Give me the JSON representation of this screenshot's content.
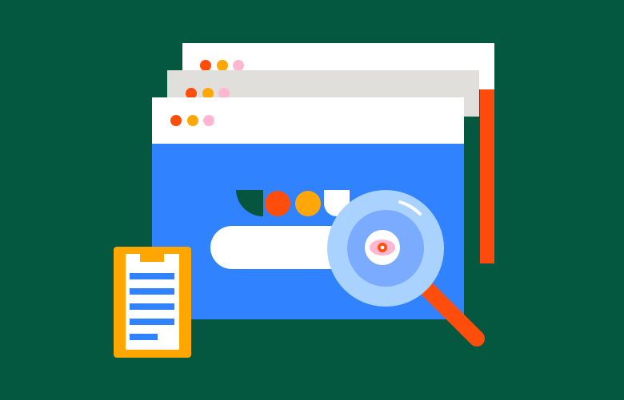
{
  "colors": {
    "background": "#055840",
    "window_back_bar": "#ffffff",
    "window_back_side": "#ff4a0e",
    "window_middle_bar": "#e1dfdb",
    "window_front_bar": "#ffffff",
    "window_front_body": "#3182ff",
    "dot_red": "#ff4d0b",
    "dot_orange": "#ffa709",
    "dot_pink": "#ffb7d1",
    "search_bar": "#ffffff",
    "logo_green": "#06563f",
    "logo_red": "#ff4d0b",
    "logo_orange": "#ffa709",
    "logo_white": "#ffffff",
    "clipboard_frame": "#ffa700",
    "clipboard_sheet": "#ffffff",
    "clipboard_lines": "#3182ff",
    "magnifier_outer": "#a9d2ff",
    "magnifier_inner": "#7aabff",
    "magnifier_handle": "#ff4d0b",
    "eye_outer": "#ffffff",
    "eye_iris": "#ffb7d1",
    "eye_pupil": "#ff4d0b"
  },
  "icons": {
    "window_controls": "traffic-light-dots",
    "logo": "colored-shapes-logo",
    "search": "magnifier-with-eye",
    "document": "clipboard-list"
  }
}
